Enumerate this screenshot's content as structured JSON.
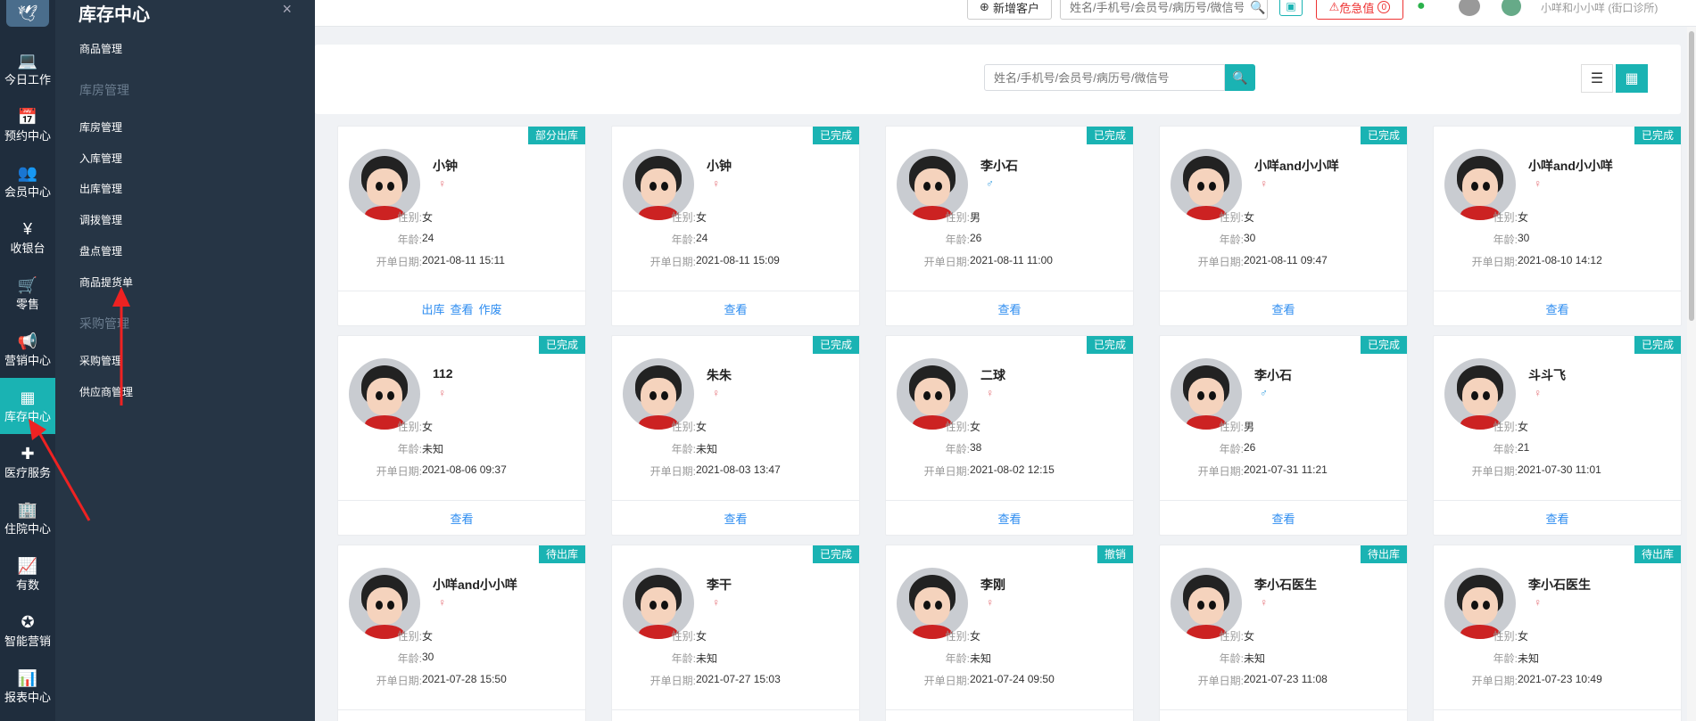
{
  "colors": {
    "accent": "#1ab3b3",
    "rail": "#1f2d3d",
    "submenu": "#263545",
    "warning": "#e33333",
    "link": "#2d8cf0"
  },
  "rail": {
    "items": [
      {
        "icon": "laptop-icon",
        "glyph": "💻",
        "label": "今日工作"
      },
      {
        "icon": "calendar-icon",
        "glyph": "📅",
        "label": "预约中心"
      },
      {
        "icon": "users-icon",
        "glyph": "👥",
        "label": "会员中心"
      },
      {
        "icon": "yen-icon",
        "glyph": "¥",
        "label": "收银台"
      },
      {
        "icon": "cart-icon",
        "glyph": "🛒",
        "label": "零售"
      },
      {
        "icon": "megaphone-icon",
        "glyph": "📢",
        "label": "营销中心"
      },
      {
        "icon": "grid-icon",
        "glyph": "▦",
        "label": "库存中心",
        "active": true
      },
      {
        "icon": "medkit-icon",
        "glyph": "✚",
        "label": "医疗服务"
      },
      {
        "icon": "building-icon",
        "glyph": "🏢",
        "label": "住院中心"
      },
      {
        "icon": "chart-line-icon",
        "glyph": "📈",
        "label": "有数"
      },
      {
        "icon": "smart-icon",
        "glyph": "✪",
        "label": "智能营销"
      },
      {
        "icon": "bar-chart-icon",
        "glyph": "📊",
        "label": "报表中心"
      }
    ]
  },
  "submenu": {
    "title": "库存中心",
    "close": "×",
    "link_goods": "商品管理",
    "group_warehouse": "库房管理",
    "link_warehouse": "库房管理",
    "link_inbound": "入库管理",
    "link_outbound": "出库管理",
    "link_transfer": "调拨管理",
    "link_inventory": "盘点管理",
    "link_pickup": "商品提货单",
    "group_purchase": "采购管理",
    "link_purchase": "采购管理",
    "link_supplier": "供应商管理"
  },
  "header": {
    "new_customer": "新增客户",
    "search_placeholder": "姓名/手机号/会员号/病历号/微信号",
    "warning": "危急值",
    "warning_count": "0",
    "user": "小咩和小小咩 (街口诊所)"
  },
  "toolbar": {
    "search_placeholder": "姓名/手机号/会员号/病历号/微信号"
  },
  "labels": {
    "gender": "性别:",
    "age": "年龄:",
    "date": "开单日期:"
  },
  "cards": [
    {
      "status": "部分出库",
      "name": "小钟",
      "sex_symbol": "♀",
      "sex_class": "f",
      "gender": "女",
      "age": "24",
      "date": "2021-08-11 15:11",
      "actions": [
        "出库",
        "查看",
        "作废"
      ]
    },
    {
      "status": "已完成",
      "name": "小钟",
      "sex_symbol": "♀",
      "sex_class": "f",
      "gender": "女",
      "age": "24",
      "date": "2021-08-11 15:09",
      "actions": [
        "查看"
      ]
    },
    {
      "status": "已完成",
      "name": "李小石",
      "sex_symbol": "♂",
      "sex_class": "m",
      "gender": "男",
      "age": "26",
      "date": "2021-08-11 11:00",
      "actions": [
        "查看"
      ]
    },
    {
      "status": "已完成",
      "name": "小咩and小小咩",
      "sex_symbol": "♀",
      "sex_class": "f",
      "gender": "女",
      "age": "30",
      "date": "2021-08-11 09:47",
      "actions": [
        "查看"
      ]
    },
    {
      "status": "已完成",
      "name": "小咩and小小咩",
      "sex_symbol": "♀",
      "sex_class": "f",
      "gender": "女",
      "age": "30",
      "date": "2021-08-10 14:12",
      "actions": [
        "查看"
      ]
    },
    {
      "status": "已完成",
      "name": "112",
      "sex_symbol": "♀",
      "sex_class": "f",
      "gender": "女",
      "age": "未知",
      "date": "2021-08-06 09:37",
      "actions": [
        "查看"
      ]
    },
    {
      "status": "已完成",
      "name": "朱朱",
      "sex_symbol": "♀",
      "sex_class": "f",
      "gender": "女",
      "age": "未知",
      "date": "2021-08-03 13:47",
      "actions": [
        "查看"
      ]
    },
    {
      "status": "已完成",
      "name": "二球",
      "sex_symbol": "♀",
      "sex_class": "f",
      "gender": "女",
      "age": "38",
      "date": "2021-08-02 12:15",
      "actions": [
        "查看"
      ]
    },
    {
      "status": "已完成",
      "name": "李小石",
      "sex_symbol": "♂",
      "sex_class": "m",
      "gender": "男",
      "age": "26",
      "date": "2021-07-31 11:21",
      "actions": [
        "查看"
      ]
    },
    {
      "status": "已完成",
      "name": "斗斗飞",
      "sex_symbol": "♀",
      "sex_class": "f",
      "gender": "女",
      "age": "21",
      "date": "2021-07-30 11:01",
      "actions": [
        "查看"
      ]
    },
    {
      "status": "待出库",
      "name": "小咩and小小咩",
      "sex_symbol": "♀",
      "sex_class": "f",
      "gender": "女",
      "age": "30",
      "date": "2021-07-28 15:50",
      "actions": []
    },
    {
      "status": "已完成",
      "name": "李干",
      "sex_symbol": "♀",
      "sex_class": "f",
      "gender": "女",
      "age": "未知",
      "date": "2021-07-27 15:03",
      "actions": []
    },
    {
      "status": "撤销",
      "name": "李刚",
      "sex_symbol": "♀",
      "sex_class": "f",
      "gender": "女",
      "age": "未知",
      "date": "2021-07-24 09:50",
      "actions": []
    },
    {
      "status": "待出库",
      "name": "李小石医生",
      "sex_symbol": "♀",
      "sex_class": "f",
      "gender": "女",
      "age": "未知",
      "date": "2021-07-23 11:08",
      "actions": []
    },
    {
      "status": "待出库",
      "name": "李小石医生",
      "sex_symbol": "♀",
      "sex_class": "f",
      "gender": "女",
      "age": "未知",
      "date": "2021-07-23 10:49",
      "actions": []
    }
  ]
}
